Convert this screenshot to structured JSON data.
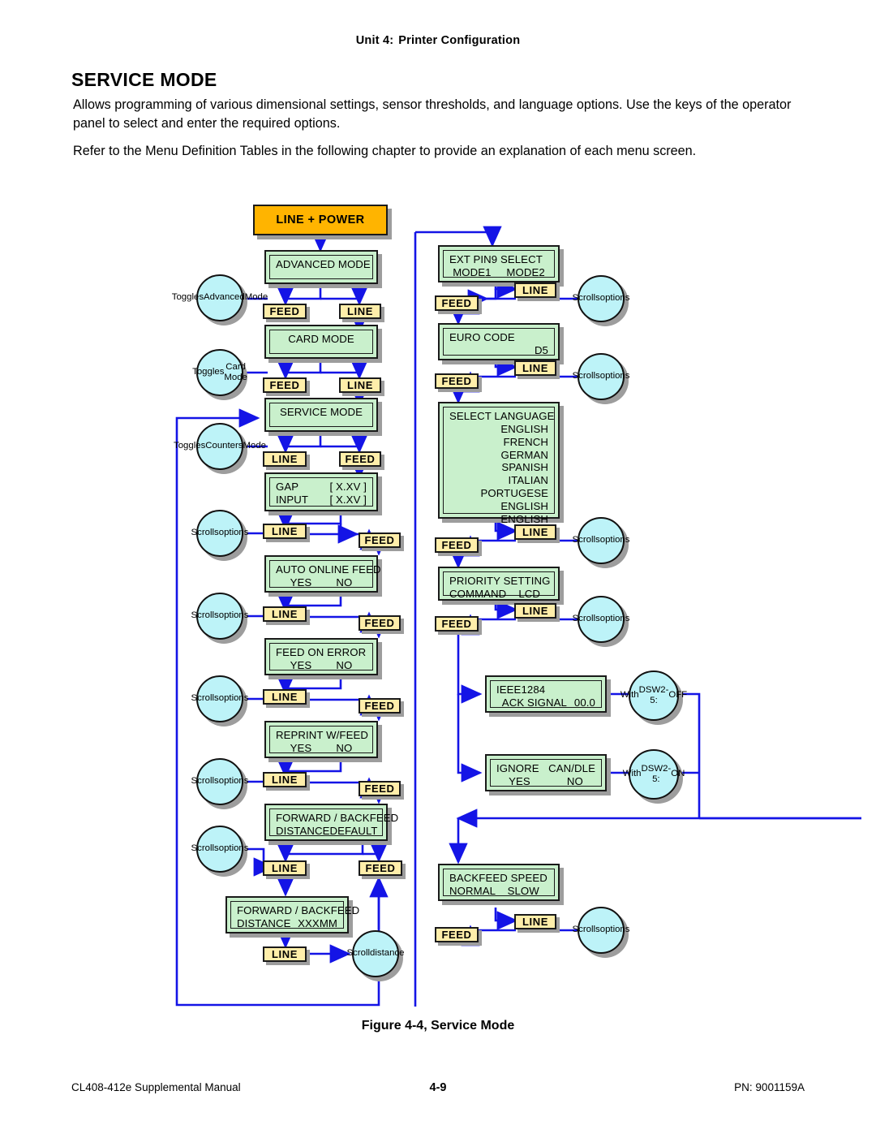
{
  "header": {
    "unit": "Unit 4:",
    "chapter": "Printer Configuration"
  },
  "title": "SERVICE MODE",
  "paragraphs": [
    "Allows programming of various dimensional settings, sensor thresholds, and language options. Use the keys of the operator panel to select and enter the required options.",
    "Refer to the Menu Definition Tables in the following chapter to provide an explanation of each menu screen."
  ],
  "figure_caption": "Figure 4-4, Service Mode",
  "footer": {
    "left": "CL408-412e Supplemental Manual",
    "center": "4-9",
    "right": "PN: 9001159A"
  },
  "colors": {
    "start_fill": "#ffb400",
    "screen_fill": "#c9f0cc",
    "key_fill": "#ffeeaa",
    "bubble_fill": "#bdf3f8",
    "connector": "#1414e6",
    "shadow": "#9d9d9d"
  },
  "diagram": {
    "start": {
      "label": "LINE + POWER"
    },
    "screens": [
      {
        "id": "advanced_mode",
        "lines": [
          {
            "text": "ADVANCED MODE",
            "align": "center"
          }
        ]
      },
      {
        "id": "card_mode",
        "lines": [
          {
            "text": "CARD MODE",
            "align": "center"
          }
        ]
      },
      {
        "id": "service_mode",
        "lines": [
          {
            "text": "SERVICE MODE",
            "align": "center"
          }
        ]
      },
      {
        "id": "gap_input",
        "lines": [
          {
            "left": "GAP",
            "right": "[ X.XV ]"
          },
          {
            "left": "INPUT",
            "right": "[ X.XV ]"
          }
        ]
      },
      {
        "id": "auto_online_feed",
        "lines": [
          {
            "text": "AUTO ONLINE FEED",
            "align": "left"
          },
          {
            "text": "YES        NO",
            "align": "center"
          }
        ]
      },
      {
        "id": "feed_on_error",
        "lines": [
          {
            "text": "FEED ON ERROR",
            "align": "left"
          },
          {
            "text": "YES        NO",
            "align": "center"
          }
        ]
      },
      {
        "id": "reprint_wfeed",
        "lines": [
          {
            "text": "REPRINT W/FEED",
            "align": "left"
          },
          {
            "text": "YES        NO",
            "align": "center"
          }
        ]
      },
      {
        "id": "fwd_backfeed_default",
        "lines": [
          {
            "text": "FORWARD / BACKFEED",
            "align": "left"
          },
          {
            "left": "DISTANCE",
            "right": "DEFAULT"
          }
        ]
      },
      {
        "id": "fwd_backfeed_xxxmm",
        "lines": [
          {
            "text": "FORWARD / BACKFEED",
            "align": "left"
          },
          {
            "left": "DISTANCE",
            "right": "XXXMM"
          }
        ]
      },
      {
        "id": "ext_pin9_select",
        "lines": [
          {
            "text": "EXT PIN9 SELECT",
            "align": "left"
          },
          {
            "text": "MODE1     MODE2",
            "align": "center"
          }
        ]
      },
      {
        "id": "euro_code",
        "lines": [
          {
            "text": "EURO CODE",
            "align": "left"
          },
          {
            "text": "D5",
            "align": "right"
          }
        ]
      },
      {
        "id": "select_language",
        "lines": [
          {
            "text": "SELECT LANGUAGE",
            "align": "left"
          },
          {
            "text": "ENGLISH",
            "align": "right"
          },
          {
            "text": "FRENCH",
            "align": "right"
          },
          {
            "text": "GERMAN",
            "align": "right"
          },
          {
            "text": "SPANISH",
            "align": "right"
          },
          {
            "text": "ITALIAN",
            "align": "right"
          },
          {
            "text": "PORTUGESE",
            "align": "right"
          },
          {
            "text": "ENGLISH",
            "align": "right"
          },
          {
            "text": "ENGLISH",
            "align": "right"
          }
        ]
      },
      {
        "id": "priority_setting",
        "lines": [
          {
            "text": "PRIORITY SETTING",
            "align": "left"
          },
          {
            "text": "COMMAND    LCD",
            "align": "left"
          }
        ]
      },
      {
        "id": "ieee1284",
        "lines": [
          {
            "text": "IEEE1284",
            "align": "left"
          },
          {
            "left": "  ACK SIGNAL",
            "right": "00.0"
          }
        ]
      },
      {
        "id": "ignore_candle",
        "lines": [
          {
            "left": "IGNORE",
            "right": "CAN/DLE"
          },
          {
            "text": "YES            NO",
            "align": "center"
          }
        ]
      },
      {
        "id": "backfeed_speed",
        "lines": [
          {
            "text": "BACKFEED SPEED",
            "align": "left"
          },
          {
            "text": "NORMAL    SLOW",
            "align": "left"
          }
        ]
      }
    ],
    "keys": [
      {
        "id": "k1",
        "label": "FEED"
      },
      {
        "id": "k2",
        "label": "LINE"
      },
      {
        "id": "k3",
        "label": "FEED"
      },
      {
        "id": "k4",
        "label": "LINE"
      },
      {
        "id": "k5",
        "label": "LINE"
      },
      {
        "id": "k6",
        "label": "FEED"
      },
      {
        "id": "k7",
        "label": "LINE"
      },
      {
        "id": "k8",
        "label": "FEED"
      },
      {
        "id": "k9",
        "label": "LINE"
      },
      {
        "id": "k10",
        "label": "FEED"
      },
      {
        "id": "k11",
        "label": "LINE"
      },
      {
        "id": "k12",
        "label": "FEED"
      },
      {
        "id": "k13",
        "label": "LINE"
      },
      {
        "id": "k14",
        "label": "FEED"
      },
      {
        "id": "k15",
        "label": "LINE"
      },
      {
        "id": "k16",
        "label": "FEED"
      },
      {
        "id": "k17",
        "label": "LINE"
      },
      {
        "id": "k18",
        "label": "FEED"
      },
      {
        "id": "k19",
        "label": "LINE"
      },
      {
        "id": "k20",
        "label": "FEED"
      },
      {
        "id": "k21",
        "label": "LINE"
      },
      {
        "id": "k22",
        "label": "FEED"
      },
      {
        "id": "k23",
        "label": "LINE"
      },
      {
        "id": "k24",
        "label": "FEED"
      },
      {
        "id": "k25",
        "label": "LINE"
      },
      {
        "id": "k26",
        "label": "FEED"
      },
      {
        "id": "k27",
        "label": "LINE"
      }
    ],
    "bubbles": [
      {
        "id": "b1",
        "text": "Toggles\nAdvanced\nMode"
      },
      {
        "id": "b2",
        "text": "Toggles\nCard Mode"
      },
      {
        "id": "b3",
        "text": "Toggles\nCounters\nMode"
      },
      {
        "id": "b4",
        "text": "Scrolls\noptions"
      },
      {
        "id": "b5",
        "text": "Scrolls\noptions"
      },
      {
        "id": "b6",
        "text": "Scrolls\noptions"
      },
      {
        "id": "b7",
        "text": "Scrolls\noptions"
      },
      {
        "id": "b8",
        "text": "Scrolls\noptions"
      },
      {
        "id": "b9",
        "text": "Scroll\ndistance"
      },
      {
        "id": "b10",
        "text": "Scrolls\noptions"
      },
      {
        "id": "b11",
        "text": "Scrolls\noptions"
      },
      {
        "id": "b12",
        "text": "Scrolls\noptions"
      },
      {
        "id": "b13",
        "text": "Scrolls\noptions"
      },
      {
        "id": "b14",
        "text": "With\nDSW2-5:\nOFF"
      },
      {
        "id": "b15",
        "text": "With\nDSW2-5:\nON"
      },
      {
        "id": "b16",
        "text": "Scrolls\noptions"
      }
    ]
  }
}
